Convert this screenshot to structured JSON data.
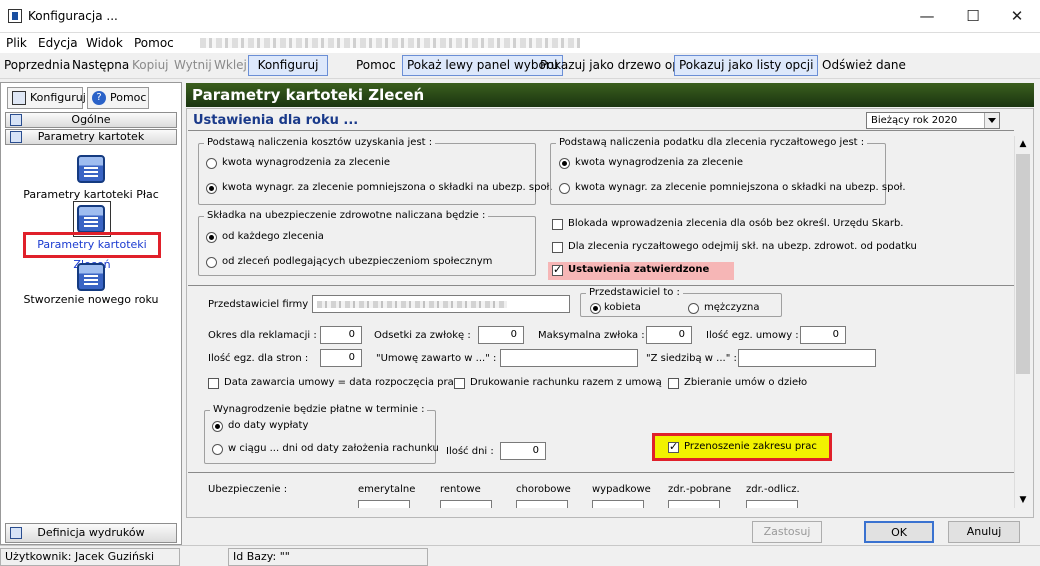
{
  "window": {
    "title": "Konfiguracja ..."
  },
  "menu": [
    "Plik",
    "Edycja",
    "Widok",
    "Pomoc"
  ],
  "toolbar": {
    "prev": "Poprzednia",
    "next": "Następna",
    "copy": "Kopiuj",
    "cut": "Wytnij",
    "paste": "Wklej",
    "konfiguruj": "Konfiguruj",
    "help": "Pomoc",
    "show_left_panel": "Pokaż lewy panel wyboru",
    "tree_view": "Pokazuj jako drzewo opcji",
    "list_view": "Pokazuj jako listy opcji",
    "refresh": "Odśwież dane"
  },
  "left": {
    "tab_konfiguruj": "Konfiguruj",
    "tab_pomoc": "Pomoc",
    "group_ogolne": "Ogólne",
    "group_parametry": "Parametry kartotek",
    "item_place": "Parametry kartoteki Płac",
    "item_zlecen": "Parametry kartoteki Zleceń",
    "item_rok": "Stworzenie nowego roku",
    "definicja": "Definicja wydruków"
  },
  "main": {
    "header": "Parametry kartoteki Zleceń",
    "settings_title": "Ustawienia dla roku ...",
    "year_select": "Bieżący rok 2020",
    "koszty": {
      "legend": "Podstawą naliczenia kosztów uzyskania jest :",
      "opt1": "kwota wynagrodzenia za zlecenie",
      "opt2": "kwota wynagr. za zlecenie pomniejszona o składki na ubezp. społ."
    },
    "podatek": {
      "legend": "Podstawą naliczenia podatku dla zlecenia ryczałtowego jest :",
      "opt1": "kwota wynagrodzenia za zlecenie",
      "opt2": "kwota wynagr. za zlecenie pomniejszona o składki na ubezp. społ."
    },
    "zdrowotne": {
      "legend": "Składka na ubezpieczenie zdrowotne naliczana będzie :",
      "opt1": "od każdego zlecenia",
      "opt2": "od zleceń podlegających ubezpieczeniom społecznym"
    },
    "chk_blokada": "Blokada wprowadzenia zlecenia dla osób bez określ. Urzędu Skarb.",
    "chk_odejmij": "Dla zlecenia ryczałtowego odejmij skł. na ubezp. zdrowot. od podatku",
    "chk_zatwierdzone": "Ustawienia zatwierdzone",
    "przedstawiciel_label": "Przedstawiciel firmy :",
    "przedstawiciel_to": "Przedstawiciel to :",
    "kobieta": "kobieta",
    "mezczyzna": "mężczyzna",
    "okres_label": "Okres dla reklamacji :",
    "okres_val": "0",
    "odsetki_label": "Odsetki za zwłokę :",
    "odsetki_val": "0",
    "zwloka_label": "Maksymalna zwłoka :",
    "zwloka_val": "0",
    "egz_umowy_label": "Ilość egz. umowy :",
    "egz_umowy_val": "0",
    "egz_stron_label": "Ilość egz. dla stron :",
    "egz_stron_val": "0",
    "zawarto_label": "\"Umowę zawarto w ...\" :",
    "siedziba_label": "\"Z siedzibą w ...\" :",
    "chk_data": "Data zawarcia umowy = data rozpoczęcia prac",
    "chk_drukowanie": "Drukowanie rachunku razem z umową",
    "chk_zbieranie": "Zbieranie umów o dzieło",
    "wynagrodzenie": {
      "legend": "Wynagrodzenie będzie płatne w terminie :",
      "opt1": "do daty wypłaty",
      "opt2": "w ciągu ... dni od daty założenia rachunku"
    },
    "ilosc_dni_label": "Ilość dni :",
    "ilosc_dni_val": "0",
    "chk_przenoszenie": "Przenoszenie zakresu prac",
    "ubezp_label": "Ubezpieczenie :",
    "ubezp_cols": [
      "emerytalne",
      "rentowe",
      "chorobowe",
      "wypadkowe",
      "zdr.-pobrane",
      "zdr.-odlicz."
    ]
  },
  "buttons": {
    "apply": "Zastosuj",
    "ok": "OK",
    "cancel": "Anuluj"
  },
  "status": {
    "user": "Użytkownik: Jacek Guziński",
    "db": "Id Bazy: \"\""
  }
}
